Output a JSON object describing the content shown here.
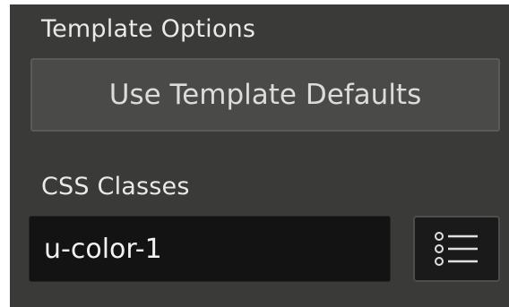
{
  "template_options": {
    "label": "Template Options",
    "defaults_button_label": "Use Template Defaults"
  },
  "css_classes": {
    "label": "CSS Classes",
    "value": "u-color-1",
    "picker_icon": "list-icon"
  }
}
